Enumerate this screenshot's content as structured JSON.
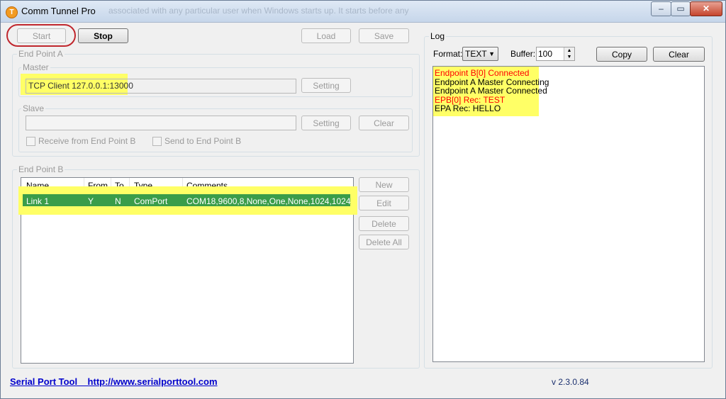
{
  "window": {
    "title": "Comm Tunnel Pro",
    "ghost_text": "associated with any particular user when Windows starts up. It starts before any",
    "minimize": "‒",
    "maximize": "▭",
    "close": "✕"
  },
  "toolbar": {
    "start": "Start",
    "stop": "Stop",
    "load": "Load",
    "save": "Save"
  },
  "endpoint_a": {
    "label": "End Point A",
    "master": {
      "label": "Master",
      "value": "TCP Client 127.0.0.1:13000",
      "setting": "Setting"
    },
    "slave": {
      "label": "Slave",
      "value": "",
      "setting": "Setting",
      "clear": "Clear",
      "receive_label": "Receive from End Point B",
      "send_label": "Send  to End Point B"
    }
  },
  "endpoint_b": {
    "label": "End Point B",
    "columns": [
      "Name",
      "From",
      "To",
      "Type",
      "Comments"
    ],
    "rows": [
      {
        "name": "Link 1",
        "from": "Y",
        "to": "N",
        "type": "ComPort",
        "comments": "COM18,9600,8,None,One,None,1024,1024"
      }
    ],
    "new": "New",
    "edit": "Edit",
    "delete": "Delete",
    "delete_all": "Delete All"
  },
  "log": {
    "label": "Log",
    "format_label": "Format:",
    "format_value": "TEXT",
    "buffer_label": "Buffer:",
    "buffer_value": "100",
    "copy": "Copy",
    "clear": "Clear",
    "lines": [
      {
        "text": "Endpoint B[0] Connected",
        "color": "#ff0000"
      },
      {
        "text": "Endpoint A Master Connecting",
        "color": "#000000"
      },
      {
        "text": "Endpoint A Master Connected",
        "color": "#000000"
      },
      {
        "text": "EPB[0] Rec: TEST",
        "color": "#ff0000"
      },
      {
        "text": "EPA Rec: HELLO",
        "color": "#000000"
      }
    ]
  },
  "footer": {
    "link_text": "Serial Port Tool    http://www.serialporttool.com",
    "version": "v 2.3.0.84"
  },
  "colors": {
    "selection": "#3a9d4a",
    "highlight": "#ffff66",
    "annotation_ring": "#c0272d"
  }
}
